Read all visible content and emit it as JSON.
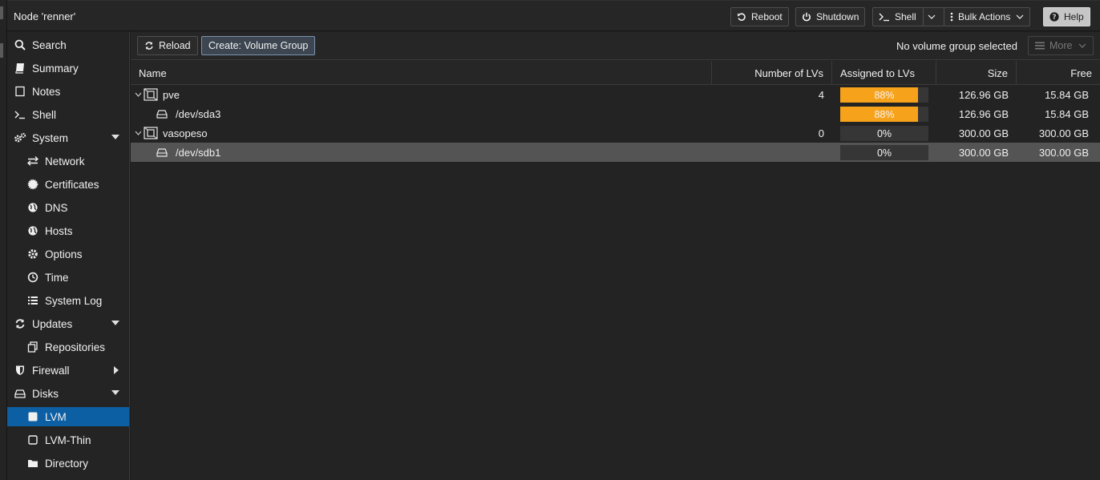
{
  "header": {
    "title": "Node 'renner'",
    "buttons": {
      "reboot": "Reboot",
      "shutdown": "Shutdown",
      "shell": "Shell",
      "bulk_actions": "Bulk Actions",
      "help": "Help"
    }
  },
  "sidebar": {
    "items": [
      {
        "label": "Search",
        "icon": "search-icon"
      },
      {
        "label": "Summary",
        "icon": "book-icon"
      },
      {
        "label": "Notes",
        "icon": "note-icon"
      },
      {
        "label": "Shell",
        "icon": "terminal-icon"
      },
      {
        "label": "System",
        "icon": "cogs-icon"
      },
      {
        "label": "Network",
        "icon": "exchange-icon"
      },
      {
        "label": "Certificates",
        "icon": "certificate-icon"
      },
      {
        "label": "DNS",
        "icon": "globe-icon"
      },
      {
        "label": "Hosts",
        "icon": "globe-icon"
      },
      {
        "label": "Options",
        "icon": "gear-icon"
      },
      {
        "label": "Time",
        "icon": "clock-icon"
      },
      {
        "label": "System Log",
        "icon": "list-icon"
      },
      {
        "label": "Updates",
        "icon": "refresh-icon"
      },
      {
        "label": "Repositories",
        "icon": "files-icon"
      },
      {
        "label": "Firewall",
        "icon": "shield-icon"
      },
      {
        "label": "Disks",
        "icon": "hdd-icon"
      },
      {
        "label": "LVM",
        "icon": "square-icon"
      },
      {
        "label": "LVM-Thin",
        "icon": "square-outline-icon"
      },
      {
        "label": "Directory",
        "icon": "folder-icon"
      }
    ]
  },
  "toolbar": {
    "reload": "Reload",
    "create": "Create: Volume Group",
    "status": "No volume group selected",
    "more": "More"
  },
  "grid": {
    "columns": {
      "name": "Name",
      "lvs": "Number of LVs",
      "assigned": "Assigned to LVs",
      "size": "Size",
      "free": "Free"
    },
    "rows": [
      {
        "name": "pve",
        "lvs": "4",
        "assigned": "88%",
        "assigned_fraction": 0.88,
        "size": "126.96 GB",
        "free": "15.84 GB"
      },
      {
        "name": "/dev/sda3",
        "lvs": "",
        "assigned": "88%",
        "assigned_fraction": 0.88,
        "size": "126.96 GB",
        "free": "15.84 GB"
      },
      {
        "name": "vasopeso",
        "lvs": "0",
        "assigned": "0%",
        "assigned_fraction": 0.0,
        "size": "300.00 GB",
        "free": "300.00 GB"
      },
      {
        "name": "/dev/sdb1",
        "lvs": "",
        "assigned": "0%",
        "assigned_fraction": 0.0,
        "size": "300.00 GB",
        "free": "300.00 GB"
      }
    ]
  },
  "colors": {
    "accent": "#0d5fa3",
    "usage_bar": "#f7a21b"
  }
}
